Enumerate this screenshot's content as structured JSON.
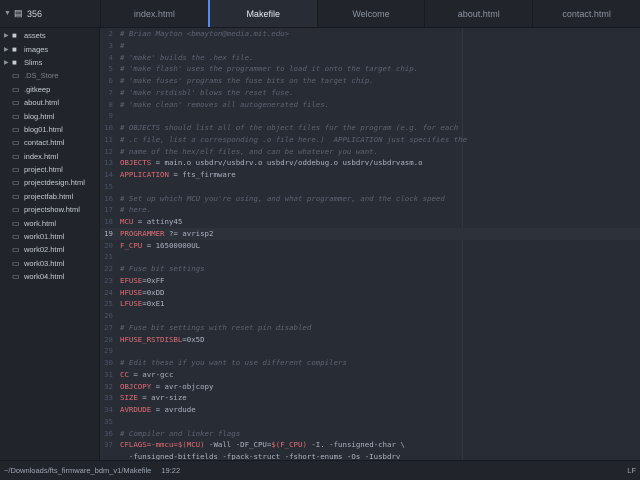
{
  "project": {
    "name": "356"
  },
  "tabs": [
    {
      "label": "index.html",
      "active": false
    },
    {
      "label": "Makefile",
      "active": true
    },
    {
      "label": "Welcome",
      "active": false
    },
    {
      "label": "about.html",
      "active": false
    },
    {
      "label": "contact.html",
      "active": false
    }
  ],
  "sidebar": {
    "items": [
      {
        "name": "assets",
        "type": "folder"
      },
      {
        "name": "images",
        "type": "folder"
      },
      {
        "name": "Slims",
        "type": "folder"
      },
      {
        "name": ".DS_Store",
        "type": "file",
        "dim": true
      },
      {
        "name": ".gitkeep",
        "type": "file"
      },
      {
        "name": "about.html",
        "type": "file"
      },
      {
        "name": "blog.html",
        "type": "file"
      },
      {
        "name": "blog01.html",
        "type": "file"
      },
      {
        "name": "contact.html",
        "type": "file"
      },
      {
        "name": "index.html",
        "type": "file"
      },
      {
        "name": "project.html",
        "type": "file"
      },
      {
        "name": "projectdesign.html",
        "type": "file"
      },
      {
        "name": "projectfab.html",
        "type": "file"
      },
      {
        "name": "projectshow.html",
        "type": "file"
      },
      {
        "name": "work.html",
        "type": "file"
      },
      {
        "name": "work01.html",
        "type": "file"
      },
      {
        "name": "work02.html",
        "type": "file"
      },
      {
        "name": "work03.html",
        "type": "file"
      },
      {
        "name": "work04.html",
        "type": "file"
      }
    ]
  },
  "editor": {
    "current_line": 19,
    "lines": [
      {
        "n": "2",
        "parts": [
          [
            "c",
            "# Brian Mayton <bmayton@media.mit.edu>"
          ]
        ]
      },
      {
        "n": "3",
        "parts": [
          [
            "c",
            "#"
          ]
        ]
      },
      {
        "n": "4",
        "parts": [
          [
            "c",
            "# 'make' builds the .hex file."
          ]
        ]
      },
      {
        "n": "5",
        "parts": [
          [
            "c",
            "# 'make flash' uses the programmer to load it onto the target chip."
          ]
        ]
      },
      {
        "n": "6",
        "parts": [
          [
            "c",
            "# 'make fuses' programs the fuse bits on the target chip."
          ]
        ]
      },
      {
        "n": "7",
        "parts": [
          [
            "c",
            "# 'make rstdisbl' blows the reset fuse."
          ]
        ]
      },
      {
        "n": "8",
        "parts": [
          [
            "c",
            "# 'make clean' removes all autogenerated files."
          ]
        ]
      },
      {
        "n": "9",
        "parts": []
      },
      {
        "n": "10",
        "parts": [
          [
            "c",
            "# OBJECTS should list all of the object files for the program (e.g. for each"
          ]
        ]
      },
      {
        "n": "11",
        "parts": [
          [
            "c",
            "# .c file, list a corresponding .o file here.)  APPLICATION just specifies the"
          ]
        ]
      },
      {
        "n": "12",
        "parts": [
          [
            "c",
            "# name of the hex/elf files, and can be whatever you want."
          ]
        ]
      },
      {
        "n": "13",
        "parts": [
          [
            "v",
            "OBJECTS"
          ],
          [
            "o",
            " = main.o usbdrv/usbdrv.o usbdrv/oddebug.o usbdrv/usbdrvasm.o"
          ]
        ]
      },
      {
        "n": "14",
        "parts": [
          [
            "v",
            "APPLICATION"
          ],
          [
            "o",
            " = fts_firmware"
          ]
        ]
      },
      {
        "n": "15",
        "parts": []
      },
      {
        "n": "16",
        "parts": [
          [
            "c",
            "# Set up which MCU you're using, and what programmer, and the clock speed"
          ]
        ]
      },
      {
        "n": "17",
        "parts": [
          [
            "c",
            "# here."
          ]
        ]
      },
      {
        "n": "18",
        "parts": [
          [
            "v",
            "MCU"
          ],
          [
            "o",
            " = attiny45"
          ]
        ]
      },
      {
        "n": "19",
        "parts": [
          [
            "v",
            "PROGRAMMER"
          ],
          [
            "o",
            " ?= avrisp2"
          ]
        ]
      },
      {
        "n": "20",
        "parts": [
          [
            "v",
            "F_CPU"
          ],
          [
            "o",
            " = 16500000UL"
          ]
        ]
      },
      {
        "n": "21",
        "parts": []
      },
      {
        "n": "22",
        "parts": [
          [
            "c",
            "# Fuse bit settings"
          ]
        ]
      },
      {
        "n": "23",
        "parts": [
          [
            "v",
            "EFUSE"
          ],
          [
            "o",
            "=0xFF"
          ]
        ]
      },
      {
        "n": "24",
        "parts": [
          [
            "v",
            "HFUSE"
          ],
          [
            "o",
            "=0xDD"
          ]
        ]
      },
      {
        "n": "25",
        "parts": [
          [
            "v",
            "LFUSE"
          ],
          [
            "o",
            "=0xE1"
          ]
        ]
      },
      {
        "n": "26",
        "parts": []
      },
      {
        "n": "27",
        "parts": [
          [
            "c",
            "# Fuse bit settings with reset pin disabled"
          ]
        ]
      },
      {
        "n": "28",
        "parts": [
          [
            "v",
            "HFUSE_RSTDISBL"
          ],
          [
            "o",
            "=0x5D"
          ]
        ]
      },
      {
        "n": "29",
        "parts": []
      },
      {
        "n": "30",
        "parts": [
          [
            "c",
            "# Edit these if you want to use different compilers"
          ]
        ]
      },
      {
        "n": "31",
        "parts": [
          [
            "v",
            "CC"
          ],
          [
            "o",
            " = avr-gcc"
          ]
        ]
      },
      {
        "n": "32",
        "parts": [
          [
            "v",
            "OBJCOPY"
          ],
          [
            "o",
            " = avr-objcopy"
          ]
        ]
      },
      {
        "n": "33",
        "parts": [
          [
            "v",
            "SIZE"
          ],
          [
            "o",
            " = avr-size"
          ]
        ]
      },
      {
        "n": "34",
        "parts": [
          [
            "v",
            "AVRDUDE"
          ],
          [
            "o",
            " = avrdude"
          ]
        ]
      },
      {
        "n": "35",
        "parts": []
      },
      {
        "n": "36",
        "parts": [
          [
            "c",
            "# Compiler and linker flags"
          ]
        ]
      },
      {
        "n": "37",
        "parts": [
          [
            "v",
            "CFLAGS=-mmcu=$(MCU)"
          ],
          [
            "o",
            " -Wall -DF_CPU="
          ],
          [
            "v",
            "$(F_CPU)"
          ],
          [
            "o",
            " -I. -funsigned-char \\"
          ]
        ]
      },
      {
        "n": "",
        "parts": [
          [
            "o",
            "  -funsigned-bitfields -fpack-struct -fshort-enums -Os -Iusbdrv"
          ]
        ]
      }
    ]
  },
  "status": {
    "path": "~/Downloads/fts_firmware_bdm_v1/Makefile",
    "cursor": "19:22",
    "line_ending": "LF"
  },
  "colors": {
    "accent": "#568af2",
    "comment": "#5c6370",
    "variable": "#e06c75",
    "text": "#abb2bf"
  }
}
